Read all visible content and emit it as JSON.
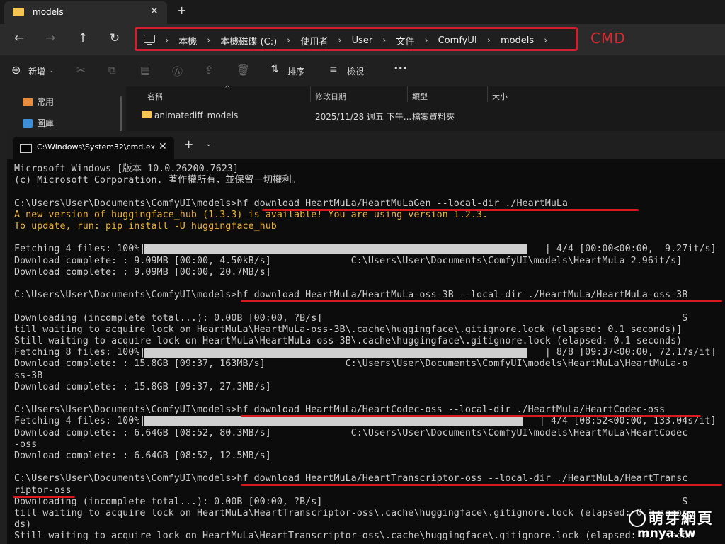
{
  "explorer": {
    "tab_title": "models",
    "tab_close": "✕",
    "new_tab": "+",
    "nav": {
      "back": "←",
      "forward": "→",
      "up": "↑",
      "refresh": "↻"
    },
    "breadcrumb": [
      "本機",
      "本機磁碟 (C:)",
      "使用者",
      "User",
      "文件",
      "ComfyUI",
      "models"
    ],
    "breadcrumb_sep": "›",
    "annotation": "CMD",
    "toolbar": {
      "new_label": "新增",
      "sort_label": "排序",
      "view_label": "檢視",
      "more": "•••"
    },
    "sidebar": [
      "常用",
      "圖庫"
    ],
    "columns": [
      "名稱",
      "修改日期",
      "類型",
      "大小"
    ],
    "rows": [
      {
        "name": "animatediff_models",
        "date": "2025/11/28 週五 下午...",
        "type": "檔案資料夾",
        "size": ""
      }
    ]
  },
  "cmd": {
    "tab_title": "C:\\Windows\\System32\\cmd.ex",
    "tab_close": "✕",
    "new_tab": "+",
    "dropdown": "⌄",
    "lines": [
      "Microsoft Windows [版本 10.0.26200.7623]",
      "(c) Microsoft Corporation. 著作權所有，並保留一切權利。",
      "",
      "C:\\Users\\User\\Documents\\ComfyUI\\models>hf download HeartMuLa/HeartMuLaGen --local-dir ./HeartMuLa",
      "A new version of huggingface_hub (1.3.3) is available! You are using version 1.2.3.",
      "To update, run: pip install -U huggingface_hub",
      "",
      "Fetching 4 files: 100%|                                                                      | 4/4 [00:00<00:00,  9.27it/s]",
      "Download complete: : 9.09MB [00:00, 4.50kB/s]              C:\\Users\\User\\Documents\\ComfyUI\\models\\HeartMuLa 2.96it/s]",
      "Download complete: : 9.09MB [00:00, 20.7MB/s]",
      "",
      "C:\\Users\\User\\Documents\\ComfyUI\\models>hf download HeartMuLa/HeartMuLa-oss-3B --local-dir ./HeartMuLa/HeartMuLa-oss-3B",
      "",
      "Downloading (incomplete total...): 0.00B [00:00, ?B/s]                                                               S",
      "till waiting to acquire lock on HeartMuLa\\HeartMuLa-oss-3B\\.cache\\huggingface\\.gitignore.lock (elapsed: 0.1 seconds)]",
      "Still waiting to acquire lock on HeartMuLa\\HeartMuLa-oss-3B\\.cache\\huggingface\\.gitignore.lock (elapsed: 0.1 seconds)",
      "Fetching 8 files: 100%|                                                                      | 8/8 [09:37<00:00, 72.17s/it]",
      "Download complete: : 15.8GB [09:37, 163MB/s]              C:\\Users\\User\\Documents\\ComfyUI\\models\\HeartMuLa\\HeartMuLa-o",
      "ss-3B",
      "Download complete: : 15.8GB [09:37, 27.3MB/s]",
      "",
      "C:\\Users\\User\\Documents\\ComfyUI\\models>hf download HeartMuLa/HeartCodec-oss --local-dir ./HeartMuLa/HeartCodec-oss",
      "Fetching 4 files: 100%|                                                                     | 4/4 [08:52<00:00, 133.04s/it]",
      "Download complete: : 6.64GB [08:52, 80.3MB/s]              C:\\Users\\User\\Documents\\ComfyUI\\models\\HeartMuLa\\HeartCodec",
      "-oss",
      "Download complete: : 6.64GB [08:52, 12.5MB/s]",
      "",
      "C:\\Users\\User\\Documents\\ComfyUI\\models>hf download HeartMuLa/HeartTranscriptor-oss --local-dir ./HeartMuLa/HeartTransc",
      "riptor-oss",
      "Downloading (incomplete total...): 0.00B [00:00, ?B/s]                                                               S",
      "till waiting to acquire lock on HeartMuLa\\HeartTranscriptor-oss\\.cache\\huggingface\\.gitignore.lock (elapsed: 0.1 secon",
      "ds)",
      "Still waiting to acquire lock on HeartMuLa\\HeartTranscriptor-oss\\.cache\\huggingface\\.gitignore.lock (elapsed: 0.1 secon"
    ]
  },
  "watermark": {
    "title": "萌芽網頁",
    "url": "mnya.tw"
  },
  "colors": {
    "annotation_red": "#d8191f",
    "warning": "#e8b13a",
    "folder": "#f5c451"
  }
}
